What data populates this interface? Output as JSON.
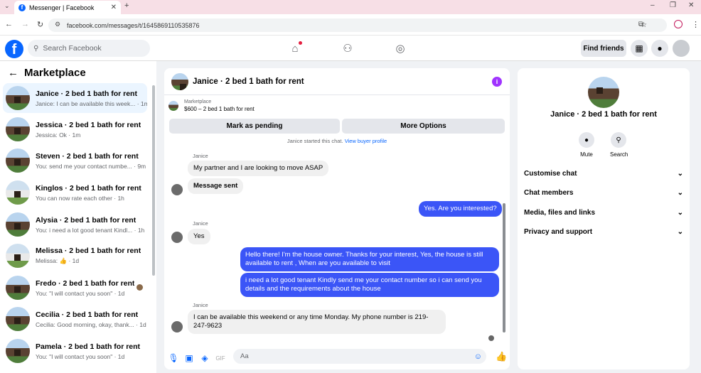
{
  "browser": {
    "tab_title": "Messenger | Facebook",
    "url": "facebook.com/messages/t/1645869110535876"
  },
  "header": {
    "search_placeholder": "Search Facebook",
    "find_friends": "Find friends"
  },
  "sidebar": {
    "title": "Marketplace",
    "conversations": [
      {
        "name": "Janice · 2 bed 1 bath for rent",
        "snippet": "Janice: I can be available this week... · 1m"
      },
      {
        "name": "Jessica · 2 bed 1 bath for rent",
        "snippet": "Jessica: Ok · 1m"
      },
      {
        "name": "Steven · 2 bed 1 bath for rent",
        "snippet": "You: send me your contact numbe... · 9m"
      },
      {
        "name": "Kinglos · 2 bed 1 bath for rent",
        "snippet": "You can now rate each other · 1h"
      },
      {
        "name": "Alysia · 2 bed 1 bath for rent",
        "snippet": "You: i need a lot good tenant Kindl... · 1h"
      },
      {
        "name": "Melissa · 2 bed 1 bath for rent",
        "snippet": "Melissa: 👍 · 1d"
      },
      {
        "name": "Fredo · 2 bed 1 bath for rent",
        "snippet": "You: \"I will contact you soon\" · 1d"
      },
      {
        "name": "Cecilia · 2 bed 1 bath for rent",
        "snippet": "Cecilia: Good morning, okay, thank... · 1d"
      },
      {
        "name": "Pamela · 2 bed 1 bath for rent",
        "snippet": "You: \"I will contact you soon\" · 1d"
      }
    ]
  },
  "chat": {
    "title": "Janice · 2 bed 1 bath for rent",
    "marketplace_label": "Marketplace",
    "listing": "$600 – 2 bed 1 bath for rent",
    "mark_pending": "Mark as pending",
    "more_options": "More Options",
    "started_text": "Janice started this chat.",
    "view_profile": "View buyer profile",
    "sender": "Janice",
    "messages": {
      "m1": "My partner and I are looking to move ASAP",
      "m2": "Message sent",
      "m3": "Yes. Are you interested?",
      "m4": "Yes",
      "m5": "Hello there! I'm the house owner. Thanks for your interest, Yes, the house is still available to rent , When are you available to visit",
      "m6": "i need a lot good tenant Kindly send me your contact number so i can send you details and the requirements about the house",
      "m7": "I can be available this weekend or any time Monday. My phone number is 219-247-9623"
    },
    "input_placeholder": "Aa"
  },
  "details": {
    "title": "Janice · 2 bed 1 bath for rent",
    "mute": "Mute",
    "search": "Search",
    "sections": [
      "Customise chat",
      "Chat members",
      "Media, files and links",
      "Privacy and support"
    ]
  }
}
